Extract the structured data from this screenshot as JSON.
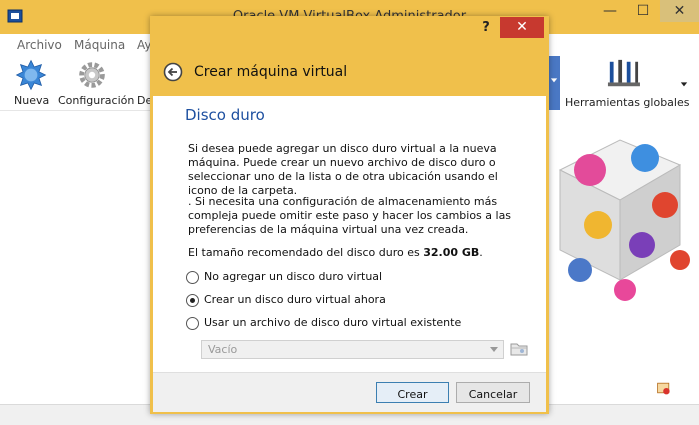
{
  "main_window": {
    "title": "Oracle VM VirtualBox Administrador",
    "menu": [
      "Archivo",
      "Máquina",
      "Ay"
    ],
    "toolbar": {
      "new_label": "Nueva",
      "settings_label": "Configuración",
      "partial_label": "De",
      "global_tools_label": "Herramientas globales"
    },
    "colors": {
      "title_bar": "#f0c04b",
      "accent_blue": "#1e50a0"
    }
  },
  "dialog": {
    "help": "?",
    "close": "✕",
    "title": "Crear máquina virtual",
    "heading": "Disco duro",
    "paragraph1": "Si desea puede agregar un disco duro virtual a la nueva máquina. Puede crear un nuevo archivo de disco duro o seleccionar uno de la lista o de otra ubicación usando el icono de la carpeta.",
    "paragraph2": ". Si necesita una configuración de almacenamiento más compleja puede omitir este paso y hacer los cambios a las preferencias de la máquina virtual una vez creada.",
    "size_text": "El tamaño recomendado del disco duro es",
    "size_value": "32.00 GB",
    "size_suffix": ".",
    "options": [
      {
        "label": "No agregar un disco duro virtual",
        "checked": false
      },
      {
        "label": "Crear un disco duro virtual ahora",
        "checked": true
      },
      {
        "label": "Usar un archivo de disco duro virtual existente",
        "checked": false
      }
    ],
    "file_combo_value": "Vacío",
    "create_button": "Crear",
    "cancel_button": "Cancelar"
  }
}
